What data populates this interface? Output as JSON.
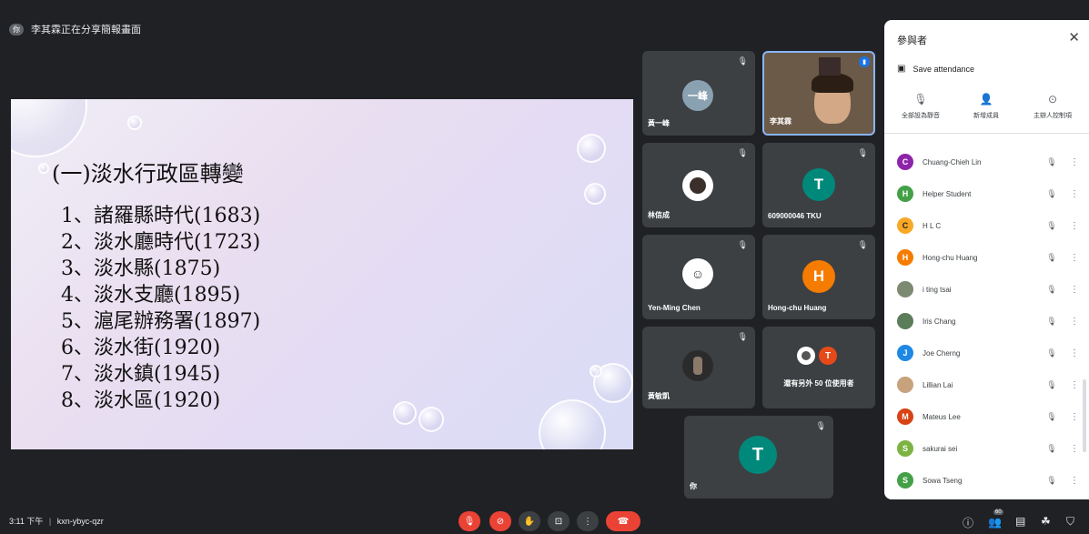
{
  "presenter": {
    "badge": "你",
    "text": "李其霖正在分享簡報畫面"
  },
  "slide": {
    "title": "(一)淡水行政區轉變",
    "items": [
      "1、諸羅縣時代(1683)",
      "2、淡水廳時代(1723)",
      "3、淡水縣(1875)",
      "4、淡水支廳(1895)",
      "5、滬尾辦務署(1897)",
      "6、淡水街(1920)",
      "7、淡水鎮(1945)",
      "8、淡水區(1920)"
    ]
  },
  "tiles": [
    {
      "name": "黃一峰",
      "avatar_text": "一峰",
      "avatar_color": "#8aa1b1"
    },
    {
      "name": "李其霖",
      "avatar_text": "",
      "avatar_color": "#6b5a48"
    },
    {
      "name": "林信成",
      "avatar_text": "",
      "avatar_color": "#ffffff"
    },
    {
      "name": "609000046 TKU",
      "avatar_text": "T",
      "avatar_color": "#00897b"
    },
    {
      "name": "Yen-Ming Chen",
      "avatar_text": "",
      "avatar_color": "#ffffff"
    },
    {
      "name": "Hong-chu Huang",
      "avatar_text": "H",
      "avatar_color": "#f57c00"
    },
    {
      "name": "黃敏凱",
      "avatar_text": "",
      "avatar_color": "#2b2b2b"
    },
    {
      "name": "還有另外 50 位使用者",
      "avatar_text": "T",
      "avatar_color": "#e64a19"
    },
    {
      "name": "你",
      "avatar_text": "T",
      "avatar_color": "#00897b"
    }
  ],
  "panel": {
    "title": "參與者",
    "save_attendance": "Save attendance",
    "actions": [
      "全部設為靜音",
      "新增成員",
      "主辦人控制項"
    ],
    "participants": [
      {
        "name": "Chuang-Chieh Lin",
        "initial": "C",
        "color": "#8e24aa"
      },
      {
        "name": "Helper Student",
        "initial": "H",
        "color": "#43a047"
      },
      {
        "name": "H L C",
        "initial": "C",
        "color": "#f9a825"
      },
      {
        "name": "Hong-chu Huang",
        "initial": "H",
        "color": "#f57c00"
      },
      {
        "name": "i ting tsai",
        "initial": "",
        "color": "#7d8a72"
      },
      {
        "name": "Iris Chang",
        "initial": "",
        "color": "#5b7d5a"
      },
      {
        "name": "Joe Cherng",
        "initial": "J",
        "color": "#1e88e5"
      },
      {
        "name": "Lillian Lai",
        "initial": "",
        "color": "#c7a27c"
      },
      {
        "name": "Mateus Lee",
        "initial": "M",
        "color": "#d84315"
      },
      {
        "name": "sakurai sei",
        "initial": "S",
        "color": "#7cb342"
      },
      {
        "name": "Sowa Tseng",
        "initial": "S",
        "color": "#43a047"
      }
    ]
  },
  "bottom": {
    "time": "3:11 下午",
    "separator": "|",
    "meeting_code": "kxn-ybyc-qzr",
    "participant_count": "60"
  },
  "colors": {
    "danger": "#ea4335",
    "control": "#3c4043",
    "background": "#202124"
  },
  "icons": [
    "mic-off-icon",
    "cam-off-icon",
    "hand-icon",
    "present-icon",
    "more-icon",
    "hangup-icon",
    "info-icon",
    "people-icon",
    "chat-icon",
    "activities-icon",
    "shield-icon",
    "close-icon"
  ]
}
